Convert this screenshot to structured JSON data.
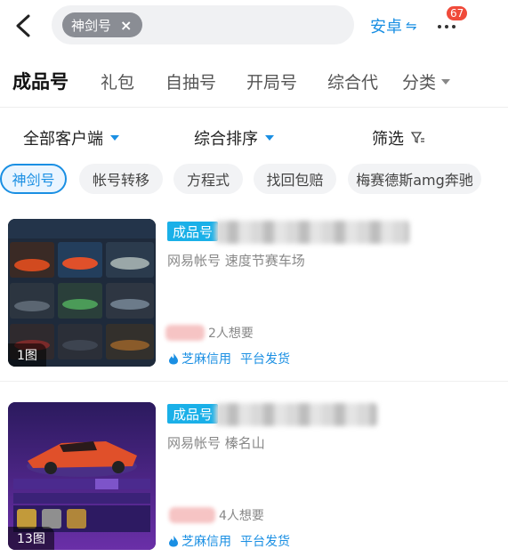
{
  "search": {
    "chip_label": "神剑号",
    "chip_close": "×"
  },
  "header": {
    "platform_label": "安卓",
    "platform_switch_glyph": "⇋",
    "notification_count": "67"
  },
  "tabs": [
    {
      "label": "成品号",
      "active": true
    },
    {
      "label": "礼包"
    },
    {
      "label": "自抽号"
    },
    {
      "label": "开局号"
    },
    {
      "label": "综合代"
    },
    {
      "label": "分类"
    }
  ],
  "filters": {
    "client": "全部客户端",
    "sort": "综合排序",
    "filter": "筛选"
  },
  "tags": [
    "神剑号",
    "帐号转移",
    "方程式",
    "找回包赔",
    "梅赛德斯amg奔驰"
  ],
  "listings": [
    {
      "type_tag": "成品号",
      "subtitle": "网易帐号  速度节赛车场",
      "wants": "2人想要",
      "image_count": "1图",
      "features": [
        "芝麻信用",
        "平台发货"
      ]
    },
    {
      "type_tag": "成品号",
      "subtitle": "网易帐号  榛名山",
      "wants": "4人想要",
      "image_count": "13图",
      "features": [
        "芝麻信用",
        "平台发货"
      ]
    }
  ],
  "colors": {
    "accent": "#1a8fe3",
    "tag": "#1ab0e8",
    "badge": "#f04a3a"
  }
}
